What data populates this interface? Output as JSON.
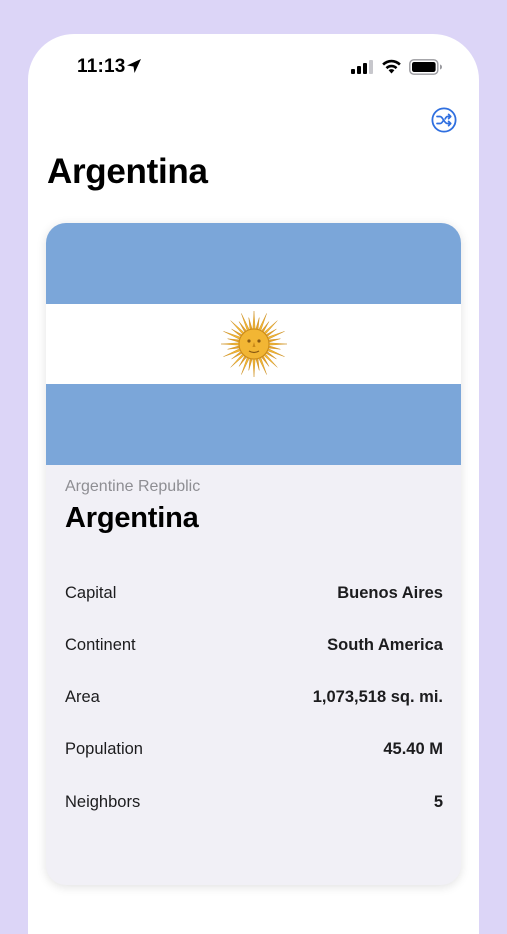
{
  "status_bar": {
    "time": "11:13",
    "icons": [
      "location-arrow-icon",
      "cellular-signal-icon",
      "wifi-icon",
      "battery-icon"
    ]
  },
  "toolbar": {
    "shuffle_icon": "shuffle-icon"
  },
  "page": {
    "title": "Argentina"
  },
  "card": {
    "flag": {
      "country": "Argentina",
      "colors": {
        "light_blue": "#7ba6d9",
        "white": "#ffffff",
        "sun": "#f2b634",
        "sun_dark": "#c98a1a"
      }
    },
    "official_name": "Argentine Republic",
    "common_name": "Argentina",
    "rows": [
      {
        "label": "Capital",
        "value": "Buenos Aires"
      },
      {
        "label": "Continent",
        "value": "South America"
      },
      {
        "label": "Area",
        "value": "1,073,518 sq. mi."
      },
      {
        "label": "Population",
        "value": "45.40 M"
      },
      {
        "label": "Neighbors",
        "value": "5"
      }
    ]
  },
  "colors": {
    "background": "#dcd5f7",
    "accent": "#2f6fe0",
    "card_background": "#f1f0f6"
  }
}
